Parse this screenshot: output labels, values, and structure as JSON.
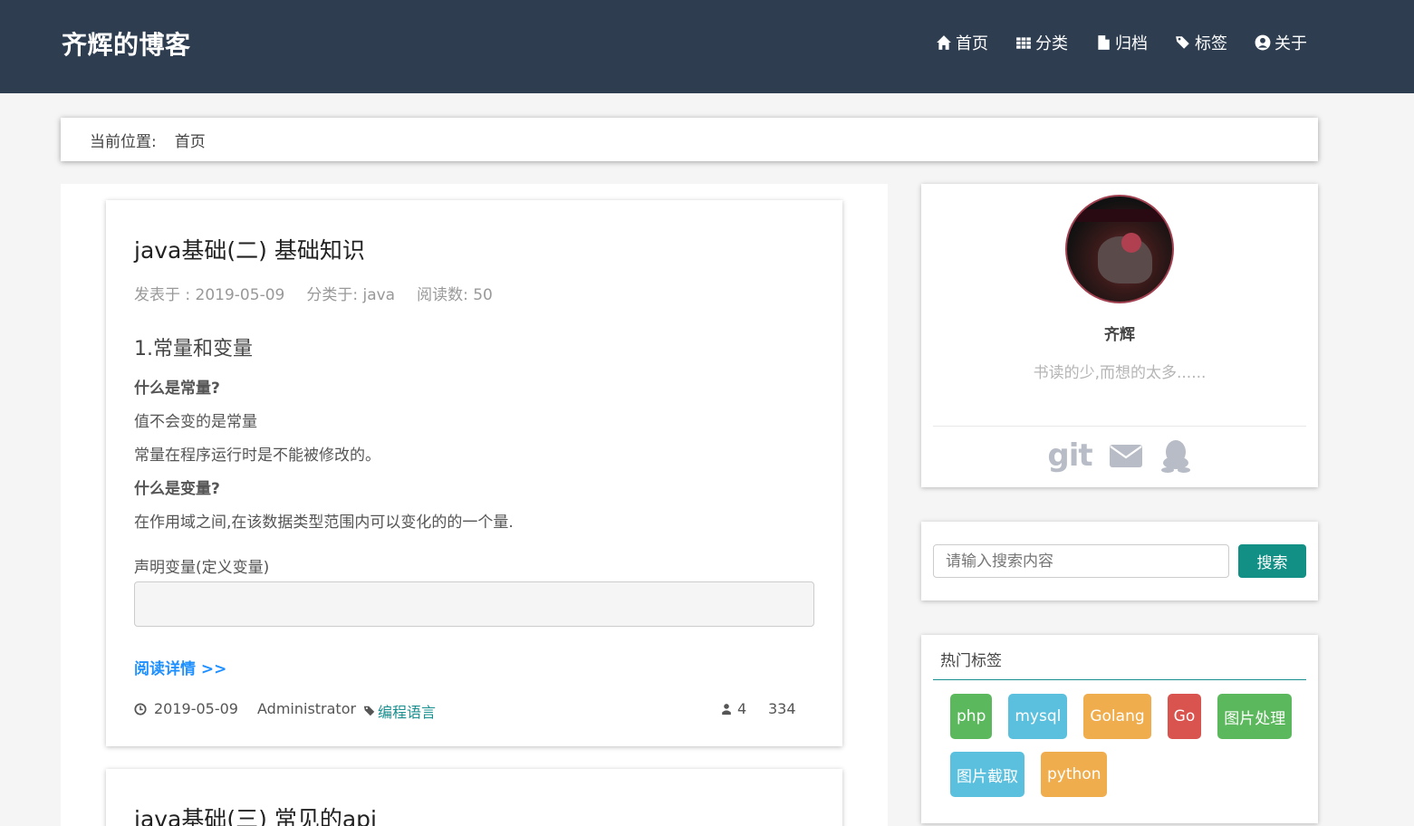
{
  "brand": "齐辉的博客",
  "nav": [
    {
      "label": "首页",
      "icon": "home-icon"
    },
    {
      "label": "分类",
      "icon": "grid-icon"
    },
    {
      "label": "归档",
      "icon": "file-icon"
    },
    {
      "label": "标签",
      "icon": "tags-icon"
    },
    {
      "label": "关于",
      "icon": "user-circle-icon"
    }
  ],
  "breadcrumb": {
    "label": "当前位置:",
    "current": "首页"
  },
  "posts": [
    {
      "title": "java基础(二) 基础知识",
      "meta": {
        "published": "发表于 : 2019-05-09",
        "category": "分类于: java",
        "reads": "阅读数: 50"
      },
      "body": {
        "heading": "1.常量和变量",
        "lines": [
          "什么是常量?",
          "值不会变的是常量",
          "常量在程序运行时是不能被修改的。",
          "什么是变量?",
          "在作用域之间,在该数据类型范围内可以变化的的一个量."
        ],
        "decl_label": "声明变量(定义变量)"
      },
      "read_more": "阅读详情 >>",
      "footer": {
        "date": "2019-05-09",
        "author": "Administrator",
        "tag": "编程语言",
        "users": "4",
        "views": "334"
      }
    },
    {
      "title": "java基础(三) 常见的api"
    }
  ],
  "profile": {
    "name": "齐辉",
    "motto": "书读的少,而想的太多......",
    "social": [
      "git-icon",
      "envelope-icon",
      "qq-icon"
    ],
    "git_text": "git"
  },
  "search": {
    "placeholder": "请输入搜索内容",
    "button": "搜索"
  },
  "hot_tags": {
    "title": "热门标签",
    "tags": [
      {
        "label": "php",
        "color": "#5cb85c"
      },
      {
        "label": "mysql",
        "color": "#5bc0de"
      },
      {
        "label": "Golang",
        "color": "#f0ad4e"
      },
      {
        "label": "Go",
        "color": "#d9534f"
      },
      {
        "label": "图片处理",
        "color": "#5cb85c"
      },
      {
        "label": "图片截取",
        "color": "#5bc0de"
      },
      {
        "label": "python",
        "color": "#f0ad4e"
      }
    ]
  },
  "colors": {
    "navbar": "#2e3e50",
    "accent": "#129085",
    "link": "#1e90ff"
  }
}
